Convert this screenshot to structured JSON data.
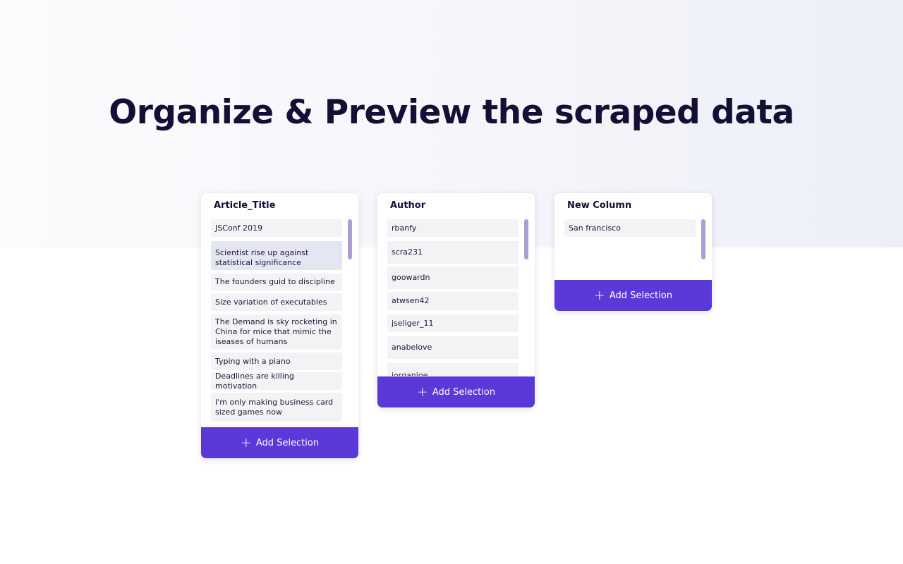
{
  "page": {
    "title": "Organize & Preview the scraped data"
  },
  "colors": {
    "accent": "#5b38d8",
    "scrollbar": "#a99fd2",
    "item_bg": "#f3f3f5",
    "selected_item_bg": "#e4e7f2",
    "title": "#150f35"
  },
  "columns": [
    {
      "title": "Article_Title",
      "items": [
        "JSConf 2019",
        "Scientist rise up against statistical significance",
        "The founders guid to discipline",
        "Size variation of executables",
        "The Demand is sky rocketing in  China for mice that mimic the iseases of humans",
        "Typing with a piano",
        "Deadlines are killing motivation",
        "I'm only making business card sized games now"
      ],
      "selected_index": 1,
      "add_label": "Add Selection",
      "add_icon": "plus-icon"
    },
    {
      "title": "Author",
      "items": [
        "rbanfy",
        "scra231",
        "goowardn",
        "atwsen42",
        "jseliger_11",
        "anabelove",
        "jorganjoe"
      ],
      "add_label": "Add Selection",
      "add_icon": "plus-icon"
    },
    {
      "title": "New Column",
      "items": [
        "San francisco"
      ],
      "add_label": "Add Selection",
      "add_icon": "plus-icon"
    }
  ]
}
